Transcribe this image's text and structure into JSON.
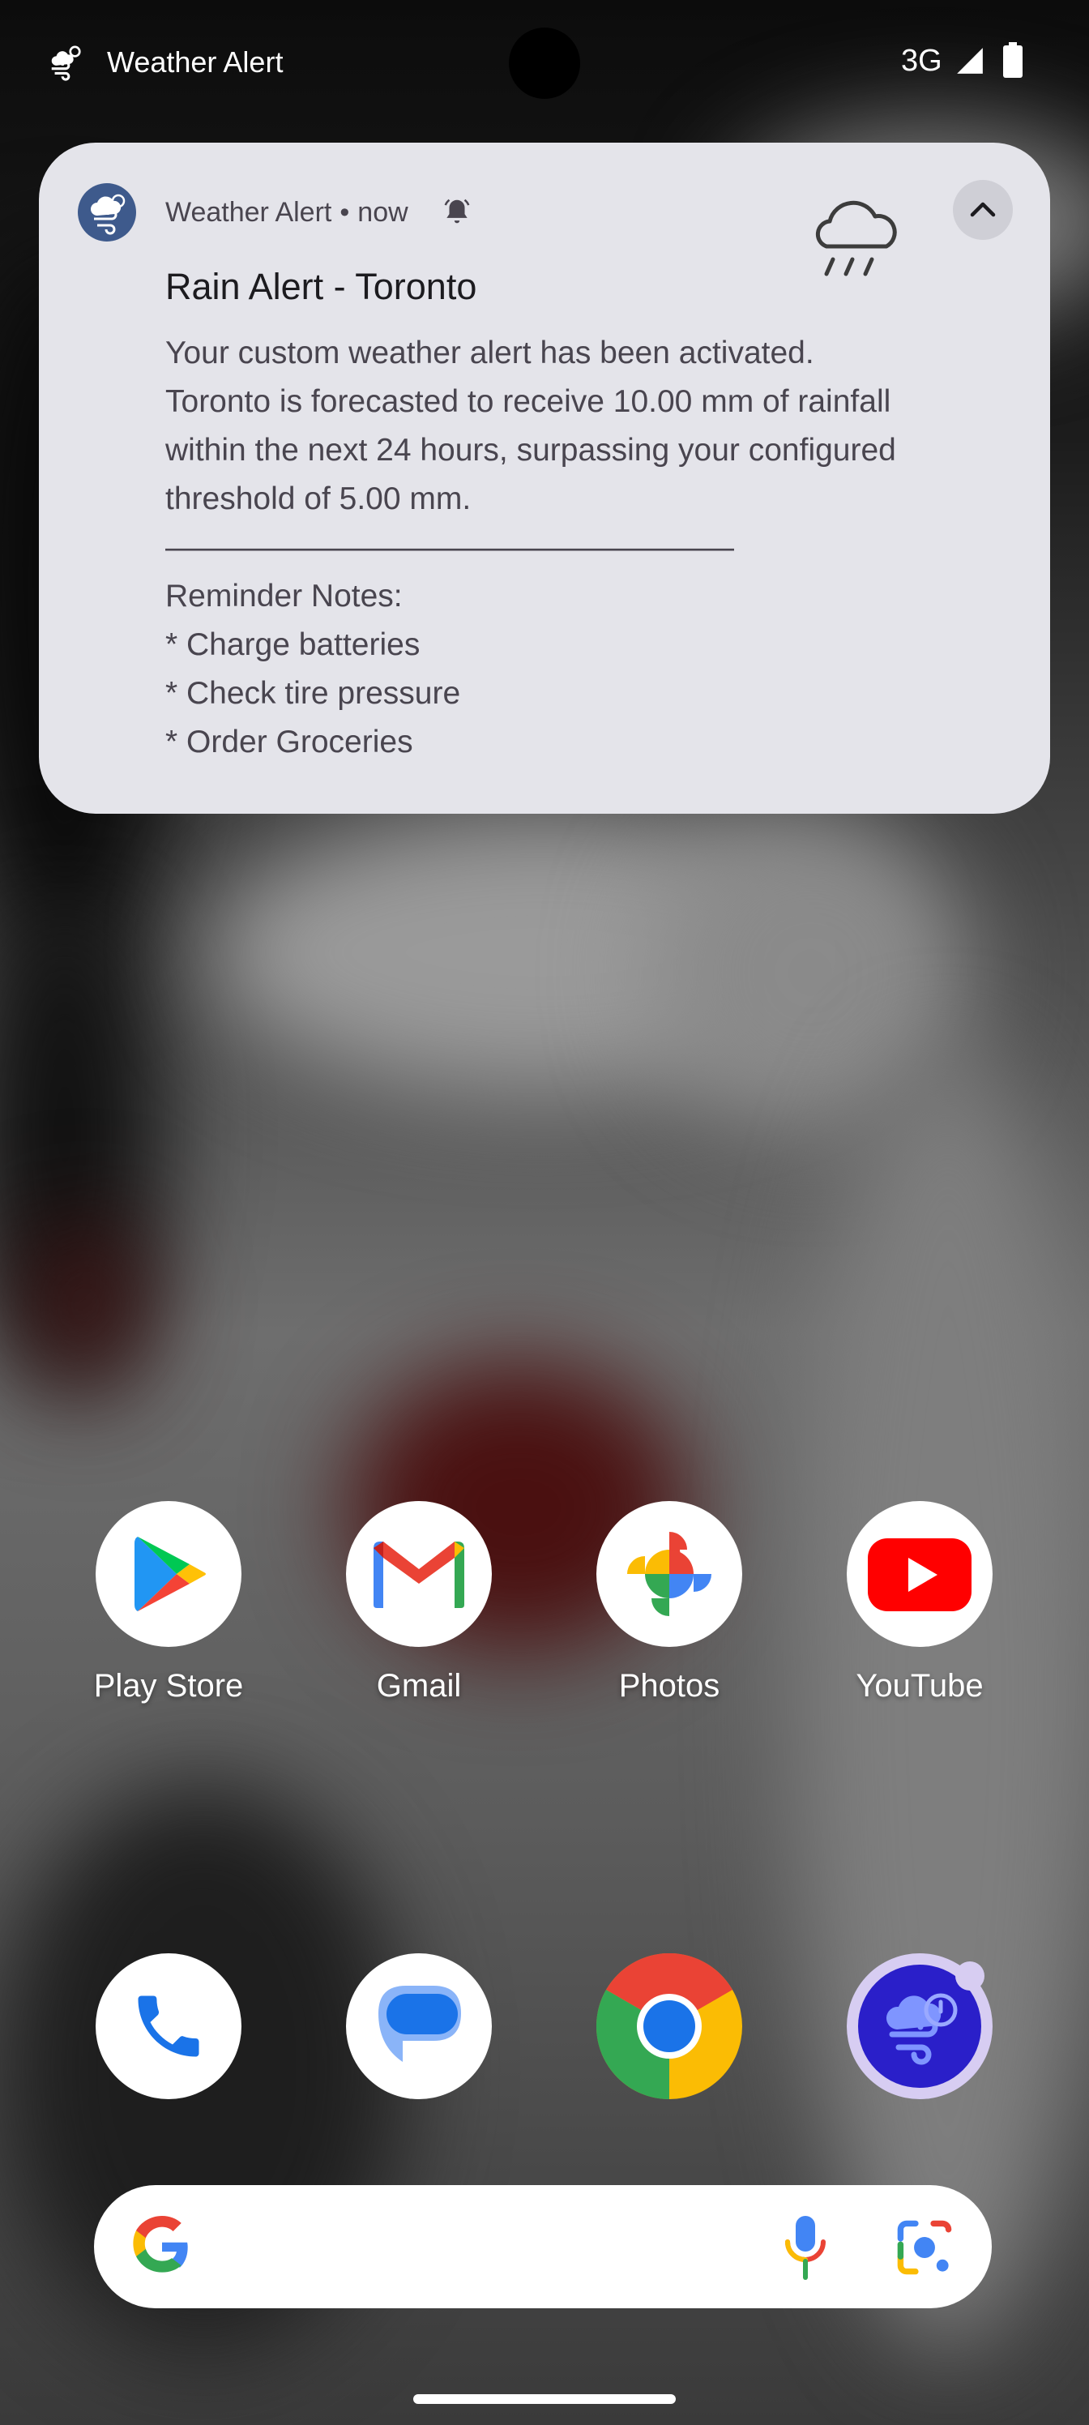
{
  "status_bar": {
    "app_name": "Weather Alert",
    "network": "3G"
  },
  "notification": {
    "app_name": "Weather Alert",
    "time": "now",
    "title": "Rain Alert - Toronto",
    "body_lines": [
      "Your custom weather alert has been activated.",
      "Toronto is forecasted to receive 10.00 mm of rainfall",
      "within the next 24 hours, surpassing your configured",
      "threshold of 5.00 mm.",
      "——————————————————",
      "Reminder Notes:",
      "* Charge batteries",
      "* Check tire pressure",
      "* Order Groceries"
    ],
    "icons": [
      "weather-app-icon",
      "bell-icon",
      "rain-cloud-icon",
      "chevron-up-icon"
    ]
  },
  "home_apps": [
    {
      "label": "Play Store",
      "icon": "play-store-icon"
    },
    {
      "label": "Gmail",
      "icon": "gmail-icon"
    },
    {
      "label": "Photos",
      "icon": "photos-icon"
    },
    {
      "label": "YouTube",
      "icon": "youtube-icon"
    }
  ],
  "dock_apps": [
    {
      "icon": "phone-icon"
    },
    {
      "icon": "messages-icon"
    },
    {
      "icon": "chrome-icon"
    },
    {
      "icon": "weather-alert-app-icon"
    }
  ],
  "search_bar": {
    "icons": [
      "google-logo-icon",
      "microphone-icon",
      "lens-icon"
    ]
  },
  "colors": {
    "notification_bg": "#e4e4ea",
    "accent": "#3e5a8c",
    "youtube_red": "#ff0000"
  }
}
